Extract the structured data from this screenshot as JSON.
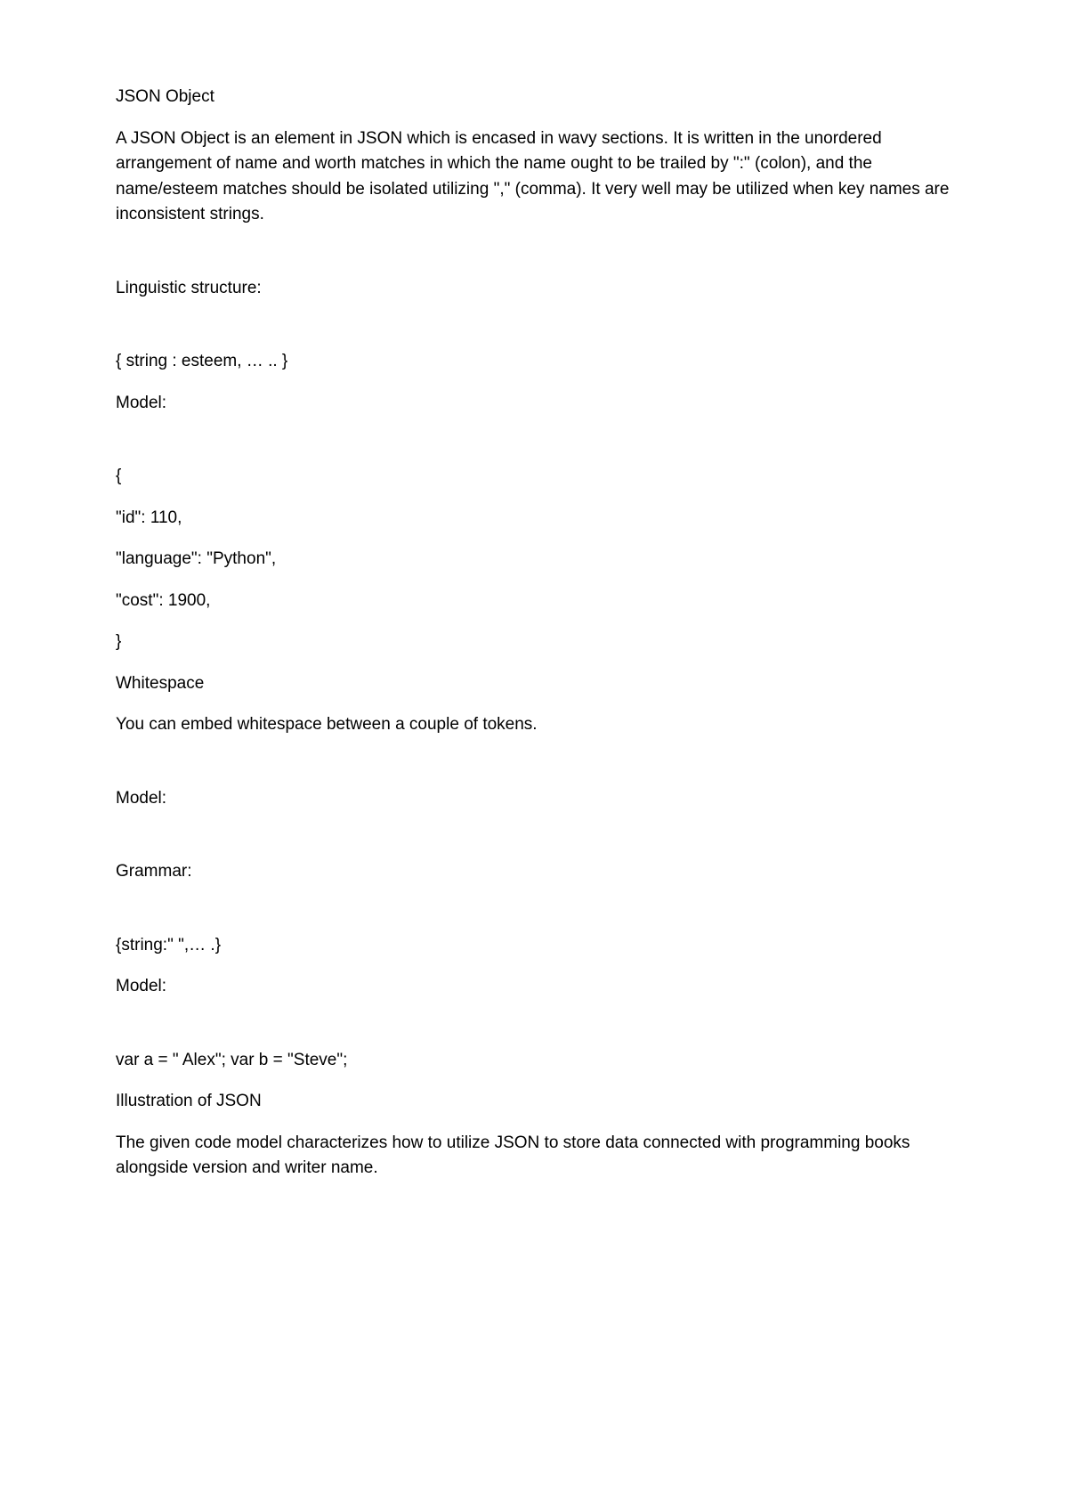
{
  "heading1": "JSON Object",
  "para1": "A JSON Object is an element in JSON which is encased in wavy sections. It is written in the unordered arrangement of name and worth matches in which the name ought to be trailed by \":\" (colon), and the name/esteem matches should be isolated utilizing \",\" (comma). It very well may be utilized when key names are inconsistent strings.",
  "label_syntax": "Linguistic structure:",
  "syntax_text": "{ string : esteem, … .. }",
  "label_model1": "Model:",
  "code_open": "{",
  "code_line1": "\"id\": 110,",
  "code_line2": "\"language\": \"Python\",",
  "code_line3": "\"cost\": 1900,",
  "code_close": "}",
  "heading2": "Whitespace",
  "para2": "You can embed whitespace between a couple of tokens.",
  "label_model2": "Model:",
  "label_grammar": "Grammar:",
  "grammar_text": "{string:\" \",… .}",
  "label_model3": "Model:",
  "var_text": "var a = \" Alex\"; var b = \"Steve\";",
  "heading3": "Illustration of JSON",
  "para3": "The given code model characterizes how to utilize JSON to store data connected with programming books alongside version and writer name."
}
